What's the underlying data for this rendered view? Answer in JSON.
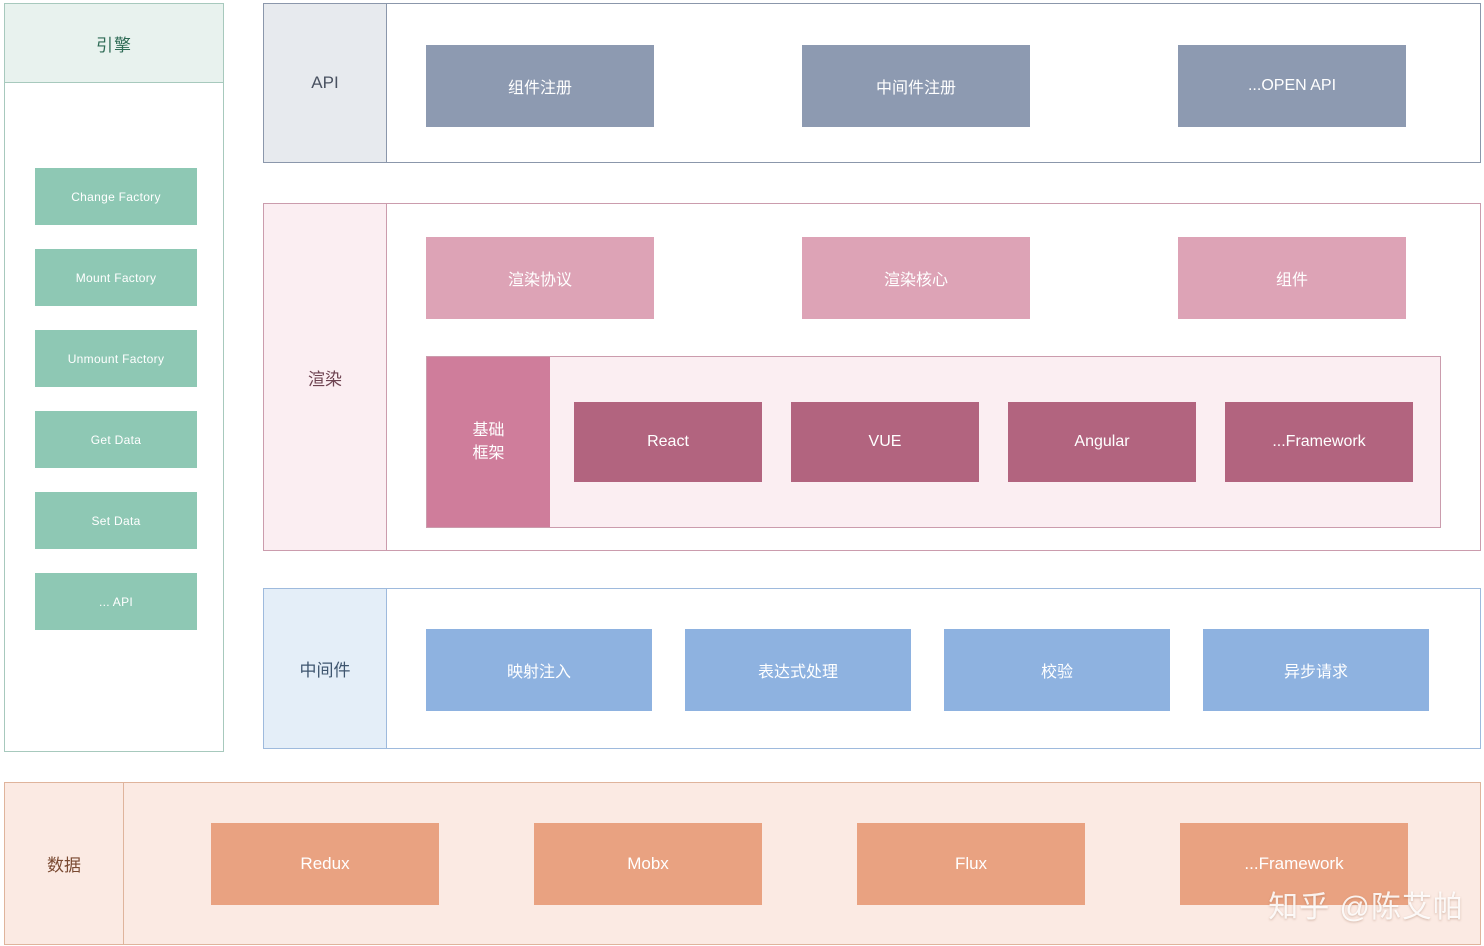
{
  "engine": {
    "title": "引擎",
    "items": [
      {
        "label": "Change Factory"
      },
      {
        "label": "Mount Factory"
      },
      {
        "label": "Unmount Factory"
      },
      {
        "label": "Get Data"
      },
      {
        "label": "Set Data"
      },
      {
        "label": "... API"
      }
    ]
  },
  "rows": {
    "api": {
      "label": "API",
      "accent": "#8d9ab1",
      "items": [
        {
          "label": "组件注册"
        },
        {
          "label": "中间件注册"
        },
        {
          "label": "...OPEN API"
        }
      ]
    },
    "render": {
      "label": "渲染",
      "accent": "#dda3b6",
      "items": [
        {
          "label": "渲染协议"
        },
        {
          "label": "渲染核心"
        },
        {
          "label": "组件"
        }
      ],
      "framework_group": {
        "label_line1": "基础",
        "label_line2": "框架",
        "items": [
          {
            "label": "React"
          },
          {
            "label": "VUE"
          },
          {
            "label": "Angular"
          },
          {
            "label": "...Framework"
          }
        ]
      }
    },
    "middleware": {
      "label": "中间件",
      "accent": "#8eb2e0",
      "items": [
        {
          "label": "映射注入"
        },
        {
          "label": "表达式处理"
        },
        {
          "label": "校验"
        },
        {
          "label": "异步请求"
        }
      ]
    },
    "data": {
      "label": "数据",
      "accent": "#e9a281",
      "items": [
        {
          "label": "Redux"
        },
        {
          "label": "Mobx"
        },
        {
          "label": "Flux"
        },
        {
          "label": "...Framework"
        }
      ]
    }
  },
  "watermark": {
    "text": "知乎 @陈艾帕"
  }
}
